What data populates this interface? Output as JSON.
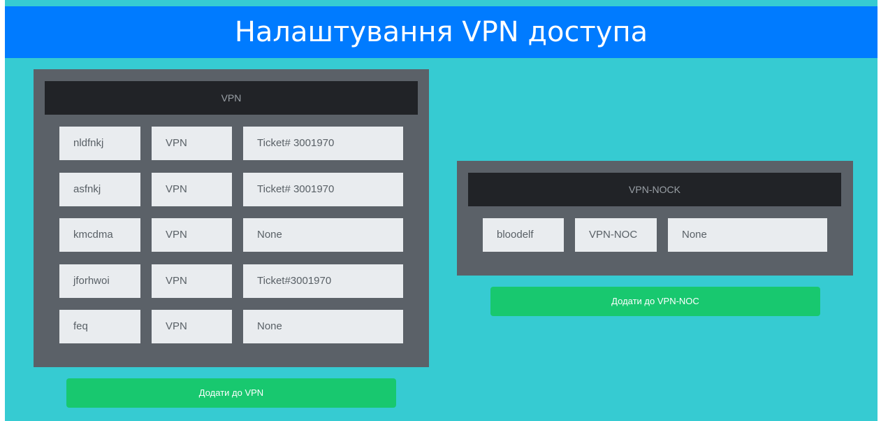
{
  "header": {
    "title": "Налаштування VPN доступа"
  },
  "vpn_panel": {
    "title": "VPN",
    "rows": [
      {
        "user": "nldfnkj",
        "group": "VPN",
        "ticket": "Ticket# 3001970"
      },
      {
        "user": "asfnkj",
        "group": "VPN",
        "ticket": "Ticket# 3001970"
      },
      {
        "user": "kmcdma",
        "group": "VPN",
        "ticket": "None"
      },
      {
        "user": "jforhwoi",
        "group": "VPN",
        "ticket": "Ticket#3001970"
      },
      {
        "user": "feq",
        "group": "VPN",
        "ticket": "None"
      }
    ],
    "add_button": "Додати до VPN"
  },
  "noc_panel": {
    "title": "VPN-NOCK",
    "rows": [
      {
        "user": "bloodelf",
        "group": "VPN-NOC",
        "ticket": "None"
      }
    ],
    "add_button": "Додати до VPN-NOC"
  },
  "colors": {
    "page_bg": "#36cbd2",
    "header_bg": "#007bff",
    "panel_bg": "#5b6168",
    "panel_title_bg": "#212327",
    "cell_bg": "#e9ecef",
    "button_bg": "#18c86f"
  }
}
